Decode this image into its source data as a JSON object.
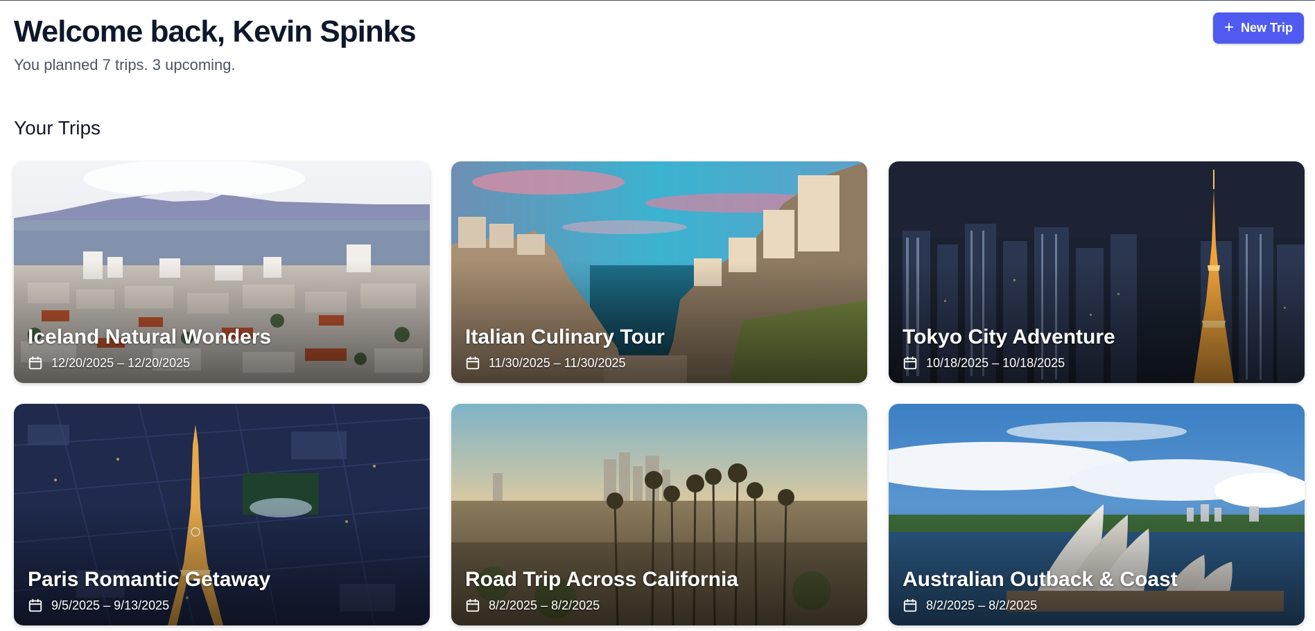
{
  "header": {
    "welcome": "Welcome back, Kevin Spinks",
    "subtitle": "You planned 7 trips. 3 upcoming."
  },
  "actions": {
    "new_trip_label": "New Trip",
    "new_trip_icon": "plus-icon"
  },
  "section": {
    "title": "Your Trips"
  },
  "trips": [
    {
      "title": "Iceland Natural Wonders",
      "dates": "12/20/2025 – 12/20/2025"
    },
    {
      "title": "Italian Culinary Tour",
      "dates": "11/30/2025 – 11/30/2025"
    },
    {
      "title": "Tokyo City Adventure",
      "dates": "10/18/2025 – 10/18/2025"
    },
    {
      "title": "Paris Romantic Getaway",
      "dates": "9/5/2025 – 9/13/2025"
    },
    {
      "title": "Road Trip Across California",
      "dates": "8/2/2025 – 8/2/2025"
    },
    {
      "title": "Australian Outback & Coast",
      "dates": "8/2/2025 – 8/2/2025"
    }
  ],
  "colors": {
    "accent": "#4f5bf0",
    "heading": "#0f172a",
    "muted": "#4b5563"
  },
  "icons": {
    "date": "calendar-icon"
  }
}
